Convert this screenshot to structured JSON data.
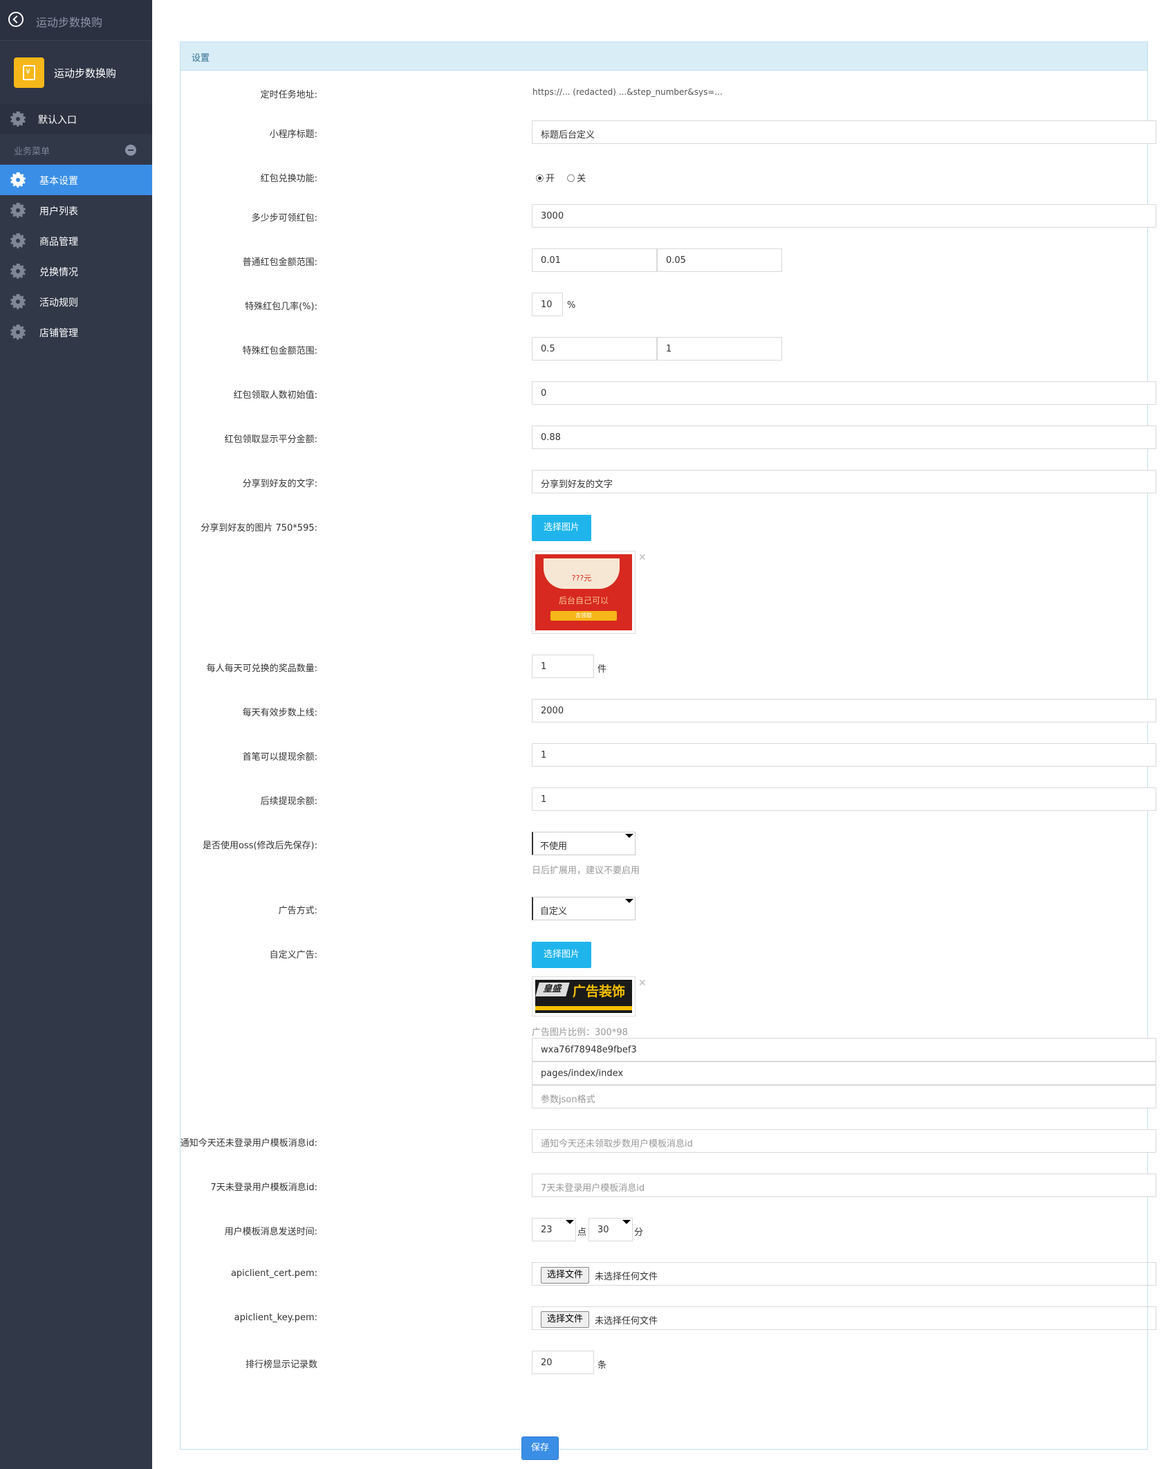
{
  "sidebar": {
    "top_title": "运动步数换购",
    "app_name": "运动步数换购",
    "default_entry": "默认入口",
    "section_title": "业务菜单",
    "items": [
      {
        "label": "基本设置",
        "active": true
      },
      {
        "label": "用户列表"
      },
      {
        "label": "商品管理"
      },
      {
        "label": "兑换情况"
      },
      {
        "label": "活动规则"
      },
      {
        "label": "店铺管理"
      }
    ]
  },
  "panel": {
    "title": "设置"
  },
  "form": {
    "cron_url": {
      "label": "定时任务地址:",
      "value": "https://... (redacted) ...&step_number&sys=..."
    },
    "mp_title": {
      "label": "小程序标题:",
      "value": "标题后台定义"
    },
    "redpack_switch": {
      "label": "红包兑换功能:",
      "on": "开",
      "off": "关",
      "selected": "开"
    },
    "steps_for_redpack": {
      "label": "多少步可领红包:",
      "value": "3000"
    },
    "normal_range": {
      "label": "普通红包金额范围:",
      "min": "0.01",
      "max": "0.05"
    },
    "special_rate": {
      "label": "特殊红包几率(%):",
      "value": "10",
      "unit": "%"
    },
    "special_range": {
      "label": "特殊红包金额范围:",
      "min": "0.5",
      "max": "1"
    },
    "init_count": {
      "label": "红包领取人数初始值:",
      "value": "0"
    },
    "avg_amount": {
      "label": "红包领取显示平分金额:",
      "value": "0.88"
    },
    "share_text": {
      "label": "分享到好友的文字:",
      "value": "分享到好友的文字"
    },
    "share_image": {
      "label": "分享到好友的图片 750*595:",
      "button": "选择图片",
      "preview_top": "???元",
      "preview_mid": "后台自己可以",
      "preview_btn": "去领取"
    },
    "daily_prizes": {
      "label": "每人每天可兑换的奖品数量:",
      "value": "1",
      "unit": "件"
    },
    "daily_step_cap": {
      "label": "每天有效步数上线:",
      "value": "2000"
    },
    "first_withdraw": {
      "label": "首笔可以提现余额:",
      "value": "1"
    },
    "later_withdraw": {
      "label": "后续提现余额:",
      "value": "1"
    },
    "use_oss": {
      "label": "是否使用oss(修改后先保存):",
      "value": "不使用",
      "help": "日后扩展用，建议不要启用"
    },
    "ad_mode": {
      "label": "广告方式:",
      "value": "自定义"
    },
    "custom_ad": {
      "label": "自定义广告:",
      "button": "选择图片",
      "preview_brand": "皇盛",
      "preview_text": "广告装饰",
      "ratio_hint": "广告图片比例：300*98",
      "appid": "wxa76f78948e9fbef3",
      "path": "pages/index/index",
      "params_placeholder": "参数json格式"
    },
    "notify_today": {
      "label": "通知今天还未登录用户模板消息id:",
      "placeholder": "通知今天还未领取步数用户模板消息id"
    },
    "notify_7days": {
      "label": "7天未登录用户模板消息id:",
      "placeholder": "7天未登录用户模板消息id"
    },
    "send_time": {
      "label": "用户模板消息发送时间:",
      "hour": "23",
      "hour_unit": "点",
      "minute": "30",
      "minute_unit": "分"
    },
    "cert_pem": {
      "label": "apiclient_cert.pem:",
      "button": "选择文件",
      "status": "未选择任何文件"
    },
    "key_pem": {
      "label": "apiclient_key.pem:",
      "button": "选择文件",
      "status": "未选择任何文件"
    },
    "rank_count": {
      "label": "排行榜显示记录数",
      "value": "20",
      "unit": "条"
    },
    "save": "保存"
  },
  "colors": {
    "sidebar_bg": "#313848",
    "active_item": "#3a8ee6",
    "panel_head": "#d9edf7",
    "image_button": "#1fb5ec",
    "scribble": "#c00000"
  }
}
